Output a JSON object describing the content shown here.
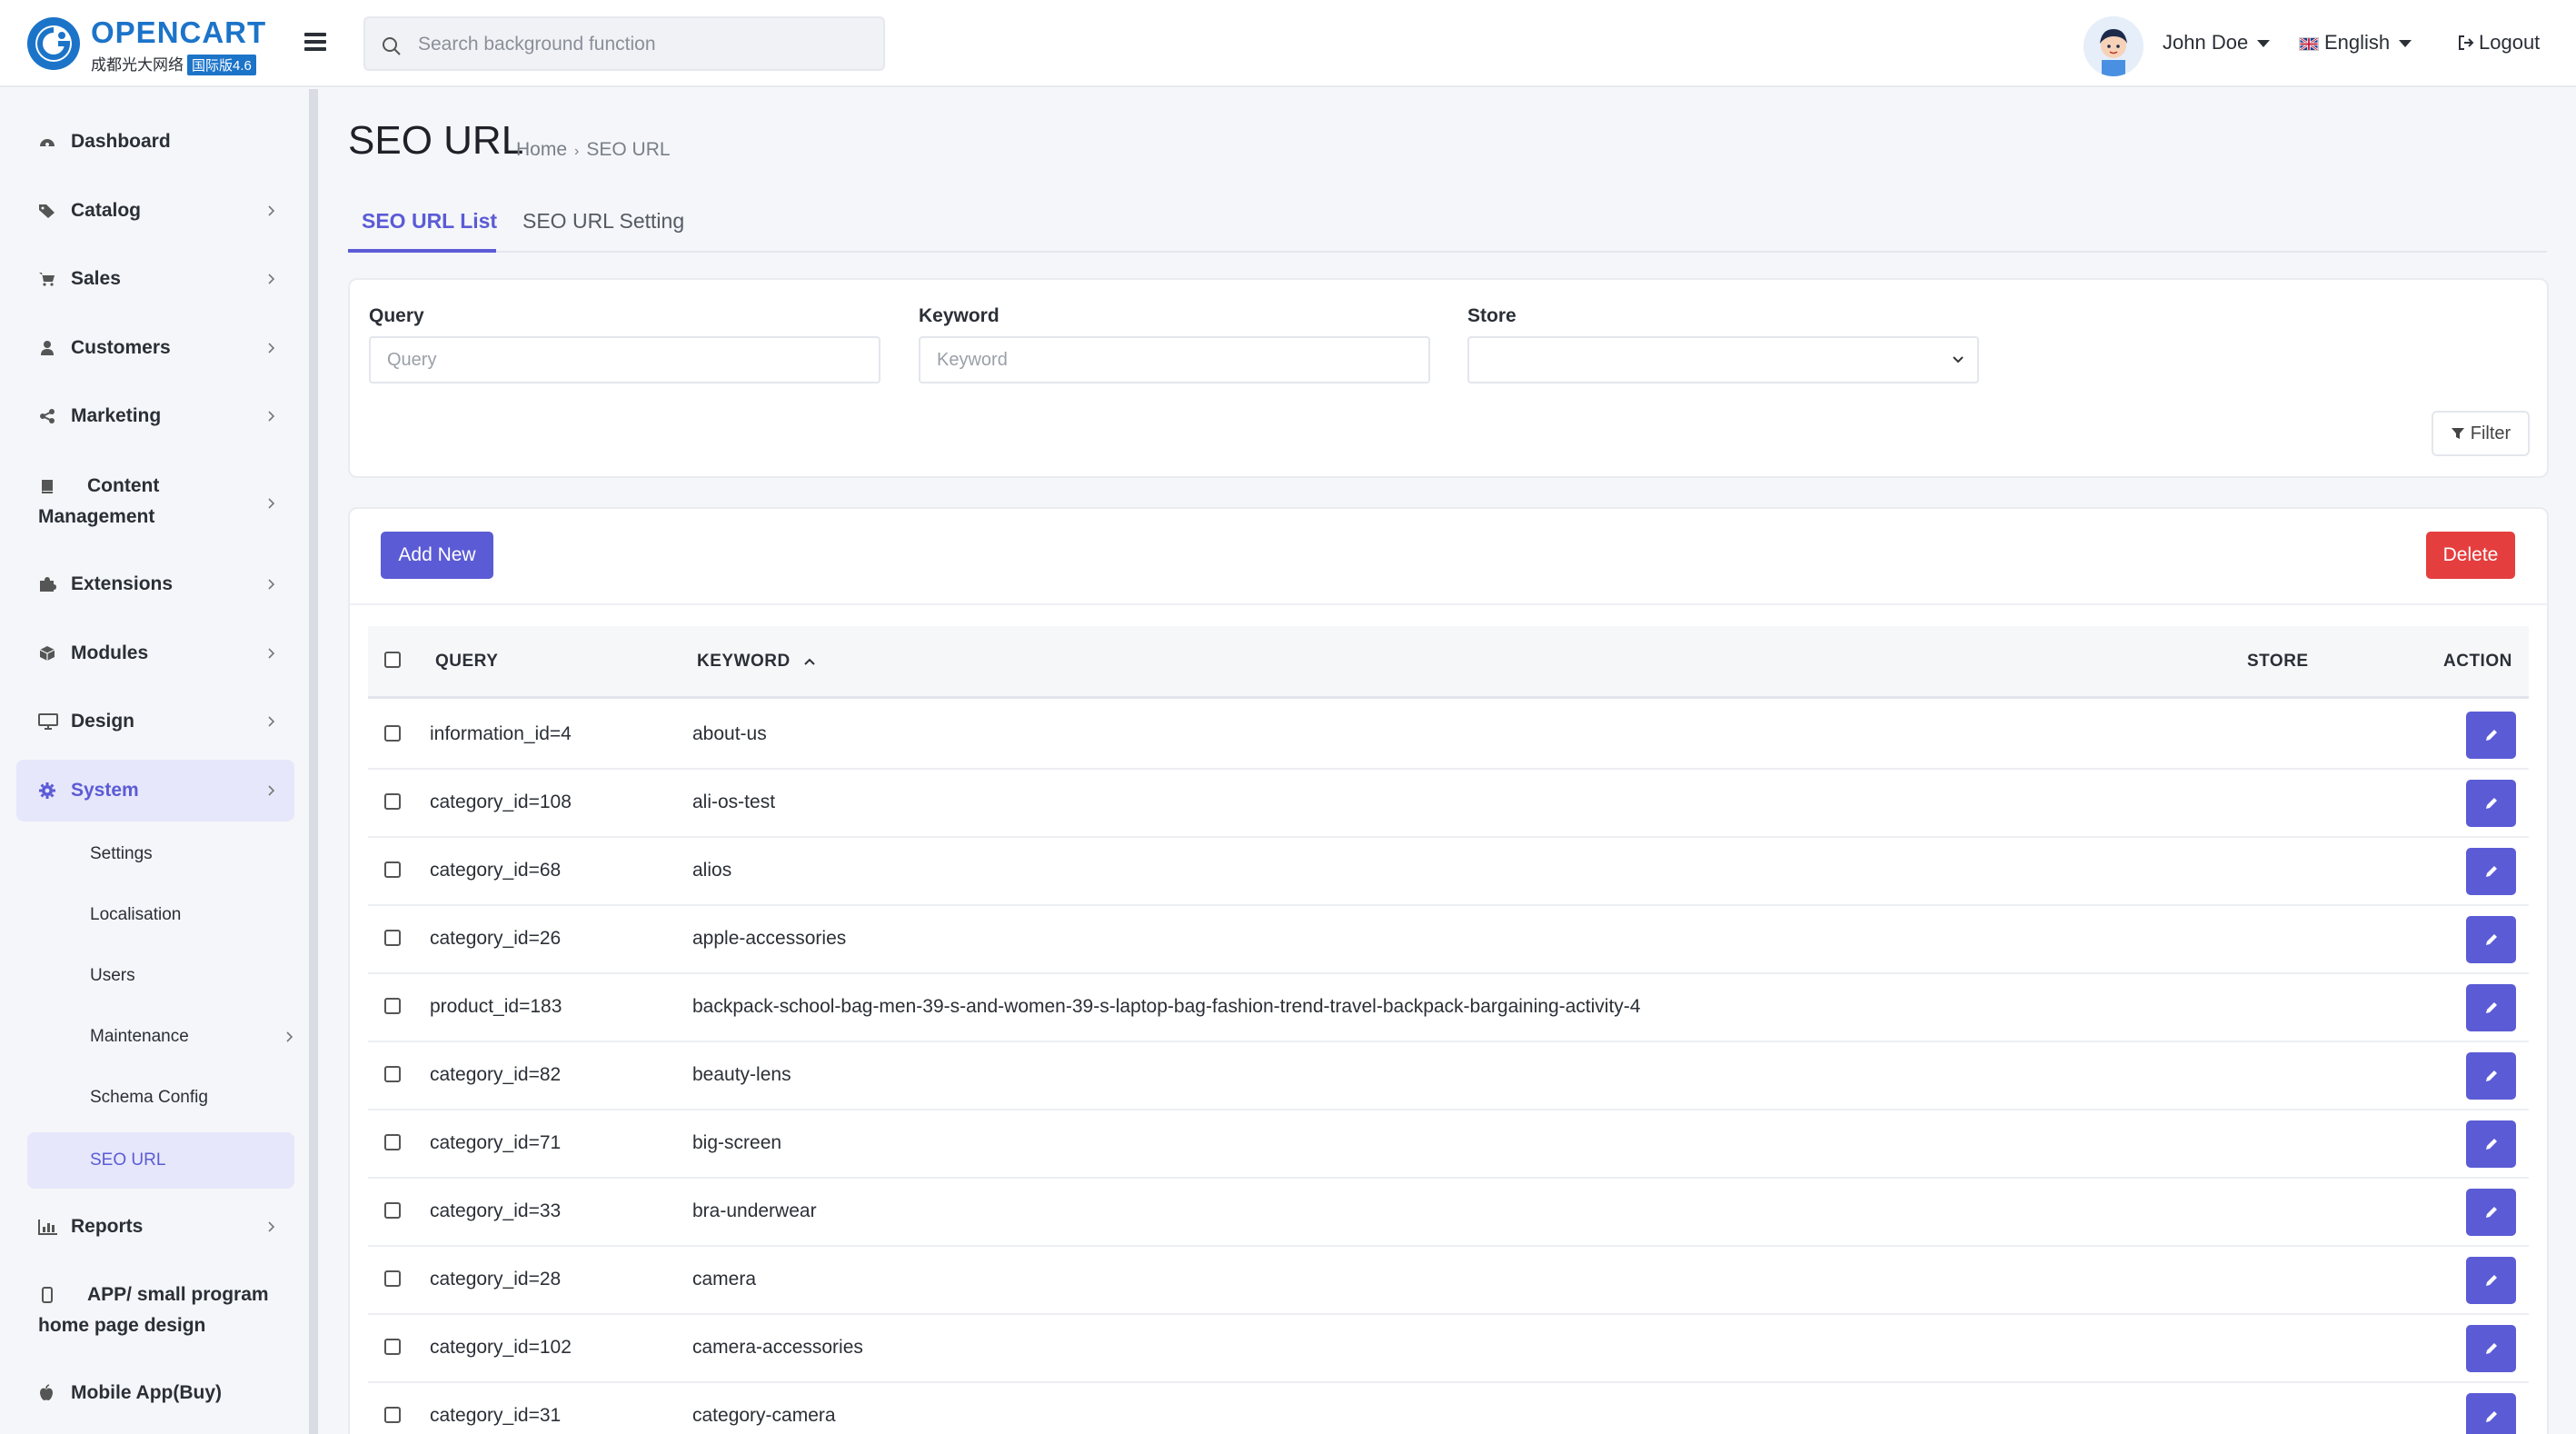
{
  "header": {
    "logo_name": "OPENCART",
    "logo_sub": "成都光大网络",
    "logo_badge": "国际版4.6",
    "search_placeholder": "Search background function",
    "user_name": "John Doe",
    "language": "English",
    "logout_label": "Logout"
  },
  "sidebar": {
    "items": [
      {
        "label": "Dashboard",
        "icon": "dashboard-icon",
        "has_children": false
      },
      {
        "label": "Catalog",
        "icon": "tag-icon",
        "has_children": true
      },
      {
        "label": "Sales",
        "icon": "cart-icon",
        "has_children": true
      },
      {
        "label": "Customers",
        "icon": "user-icon",
        "has_children": true
      },
      {
        "label": "Marketing",
        "icon": "share-icon",
        "has_children": true
      },
      {
        "label": "Content Management",
        "icon": "book-icon",
        "has_children": true
      },
      {
        "label": "Extensions",
        "icon": "puzzle-icon",
        "has_children": true
      },
      {
        "label": "Modules",
        "icon": "cube-icon",
        "has_children": true
      },
      {
        "label": "Design",
        "icon": "monitor-icon",
        "has_children": true
      },
      {
        "label": "System",
        "icon": "gear-icon",
        "has_children": true,
        "active": true
      },
      {
        "label": "Reports",
        "icon": "bar-chart-icon",
        "has_children": true
      },
      {
        "label": "APP/ small program home page design",
        "icon": "mobile-icon",
        "has_children": false
      },
      {
        "label": "Mobile App(Buy)",
        "icon": "apple-icon",
        "has_children": false
      }
    ],
    "system_children": [
      {
        "label": "Settings"
      },
      {
        "label": "Localisation"
      },
      {
        "label": "Users"
      },
      {
        "label": "Maintenance",
        "has_children": true
      },
      {
        "label": "Schema Config"
      },
      {
        "label": "SEO URL",
        "active": true
      }
    ]
  },
  "page": {
    "title": "SEO URL",
    "breadcrumb": [
      "Home",
      "SEO URL"
    ],
    "tabs": [
      {
        "label": "SEO URL List",
        "active": true
      },
      {
        "label": "SEO URL Setting",
        "active": false
      }
    ]
  },
  "filter": {
    "query_label": "Query",
    "query_placeholder": "Query",
    "keyword_label": "Keyword",
    "keyword_placeholder": "Keyword",
    "store_label": "Store",
    "store_value": "",
    "filter_button": "Filter"
  },
  "list": {
    "add_button": "Add New",
    "delete_button": "Delete",
    "columns": {
      "query": "QUERY",
      "keyword": "KEYWORD",
      "store": "STORE",
      "action": "ACTION"
    },
    "sort": {
      "column": "keyword",
      "direction": "asc"
    },
    "rows": [
      {
        "query": "information_id=4",
        "keyword": "about-us",
        "store": ""
      },
      {
        "query": "category_id=108",
        "keyword": "ali-os-test",
        "store": ""
      },
      {
        "query": "category_id=68",
        "keyword": "alios",
        "store": ""
      },
      {
        "query": "category_id=26",
        "keyword": "apple-accessories",
        "store": ""
      },
      {
        "query": "product_id=183",
        "keyword": "backpack-school-bag-men-39-s-and-women-39-s-laptop-bag-fashion-trend-travel-backpack-bargaining-activity-4",
        "store": ""
      },
      {
        "query": "category_id=82",
        "keyword": "beauty-lens",
        "store": ""
      },
      {
        "query": "category_id=71",
        "keyword": "big-screen",
        "store": ""
      },
      {
        "query": "category_id=33",
        "keyword": "bra-underwear",
        "store": ""
      },
      {
        "query": "category_id=28",
        "keyword": "camera",
        "store": ""
      },
      {
        "query": "category_id=102",
        "keyword": "camera-accessories",
        "store": ""
      },
      {
        "query": "category_id=31",
        "keyword": "category-camera",
        "store": ""
      }
    ]
  },
  "colors": {
    "accent": "#5b5bd6",
    "danger": "#e53e3e",
    "brand": "#1c74c9"
  }
}
